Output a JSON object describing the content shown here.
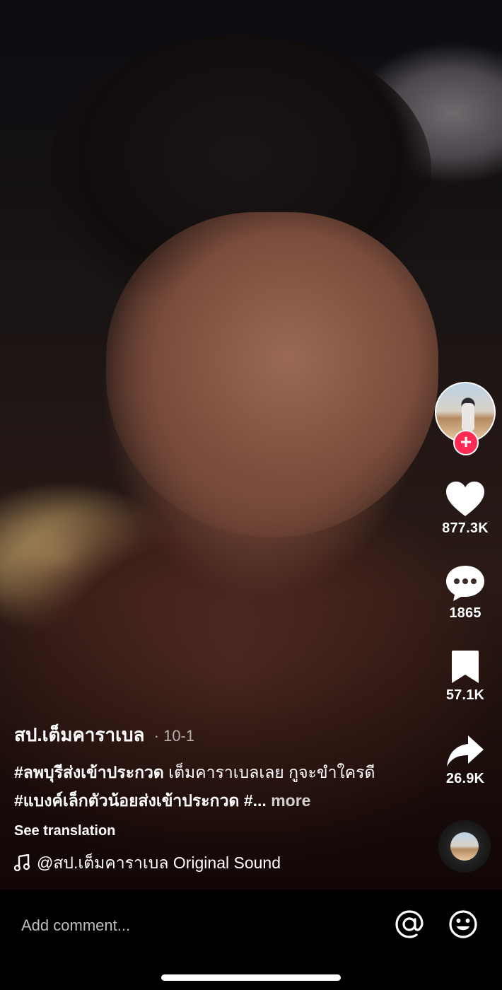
{
  "video": {
    "author": "สป.เต็มคาราเบล",
    "date_separator": "·",
    "date": "10-1",
    "description": {
      "hashtag_1": "#ลพบุรีส่งเข้าประกวด",
      "text_1": "  เต็มคาราเบลเลย กูจะขำใครดี ",
      "hashtag_2": "#แบงค์เล็กตัวน้อยส่งเข้าประกวด",
      "text_2": " #",
      "ellipsis": "...",
      "more_label": "more"
    },
    "see_translation": "See translation",
    "music": "@สป.เต็มคาราเบล Original Sound"
  },
  "actions": {
    "follow_symbol": "+",
    "likes": "877.3K",
    "comments": "1865",
    "saves": "57.1K",
    "shares": "26.9K"
  },
  "comment_bar": {
    "placeholder": "Add comment..."
  },
  "colors": {
    "follow_red": "#fe2c55",
    "text_white": "#ffffff",
    "placeholder_gray": "#bdbdbd"
  },
  "icons": {
    "like": "heart-icon",
    "comment": "speech-bubble-icon",
    "save": "bookmark-icon",
    "share": "share-arrow-icon",
    "music": "music-note-icon",
    "mention": "at-sign-icon",
    "emoji": "smiley-icon"
  }
}
